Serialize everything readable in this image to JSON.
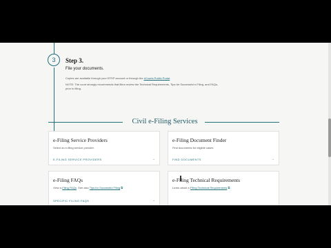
{
  "step": {
    "number": "3",
    "title": "Step 3.",
    "subtitle": "File your documents.",
    "text_before_link": "Copies are available through your EFSP account or through the ",
    "link": "eCourts Public Portal",
    "text_after_link": ".",
    "note": "NOTE: The court strongly recommends that filers review the Technical Requirements, Tips for Successful e-Filing, and FAQs, prior to filing."
  },
  "section_title": "Civil e-Filing Services",
  "cards": [
    {
      "title": "e-Filing Service Providers",
      "desc": "Select an e-filing service provider.",
      "link_label": "E-FILING SERVICE PROVIDERS",
      "arrow": "→"
    },
    {
      "title": "e-Filing Document Finder",
      "desc": "Find documents for eligible cases",
      "link_label": "FIND DOCUMENTS",
      "arrow": "→"
    },
    {
      "title": "e-Filing FAQs",
      "desc_before": "View e-",
      "desc_link1": "Filing FAQs",
      "desc_mid": ". See also ",
      "desc_link2": "Tips for Successful Filing",
      "link_label": "SPECIFIC FILING FAQS",
      "arrow": "→"
    },
    {
      "title": "e-Filing Technical Requirements",
      "desc_before": "Learn about e-",
      "desc_link1": "Filing Technical Requirements",
      "link_label": "",
      "arrow": ""
    }
  ]
}
